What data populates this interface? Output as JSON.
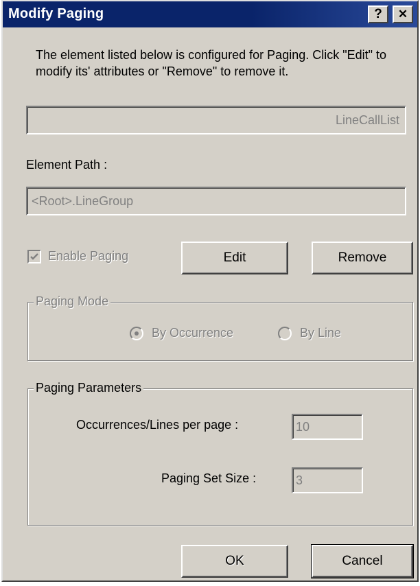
{
  "window": {
    "title": "Modify Paging",
    "help_button": "?",
    "close_button": "✕"
  },
  "description": "The element listed below is configured for Paging. Click \"Edit\" to modify its' attributes or \"Remove\" to remove it.",
  "element_name_value": "LineCallList",
  "element_path": {
    "label": "Element Path :",
    "value": "<Root>.LineGroup"
  },
  "enable_paging": {
    "label": "Enable Paging",
    "checked": true
  },
  "buttons": {
    "edit": "Edit",
    "remove": "Remove",
    "ok": "OK",
    "cancel": "Cancel"
  },
  "paging_mode": {
    "title": "Paging Mode",
    "options": [
      "By Occurrence",
      "By Line"
    ],
    "selected": "By Occurrence"
  },
  "paging_parameters": {
    "title": "Paging Parameters",
    "per_page_label": "Occurrences/Lines per page :",
    "per_page_value": "10",
    "set_size_label": "Paging Set Size :",
    "set_size_value": "3"
  }
}
